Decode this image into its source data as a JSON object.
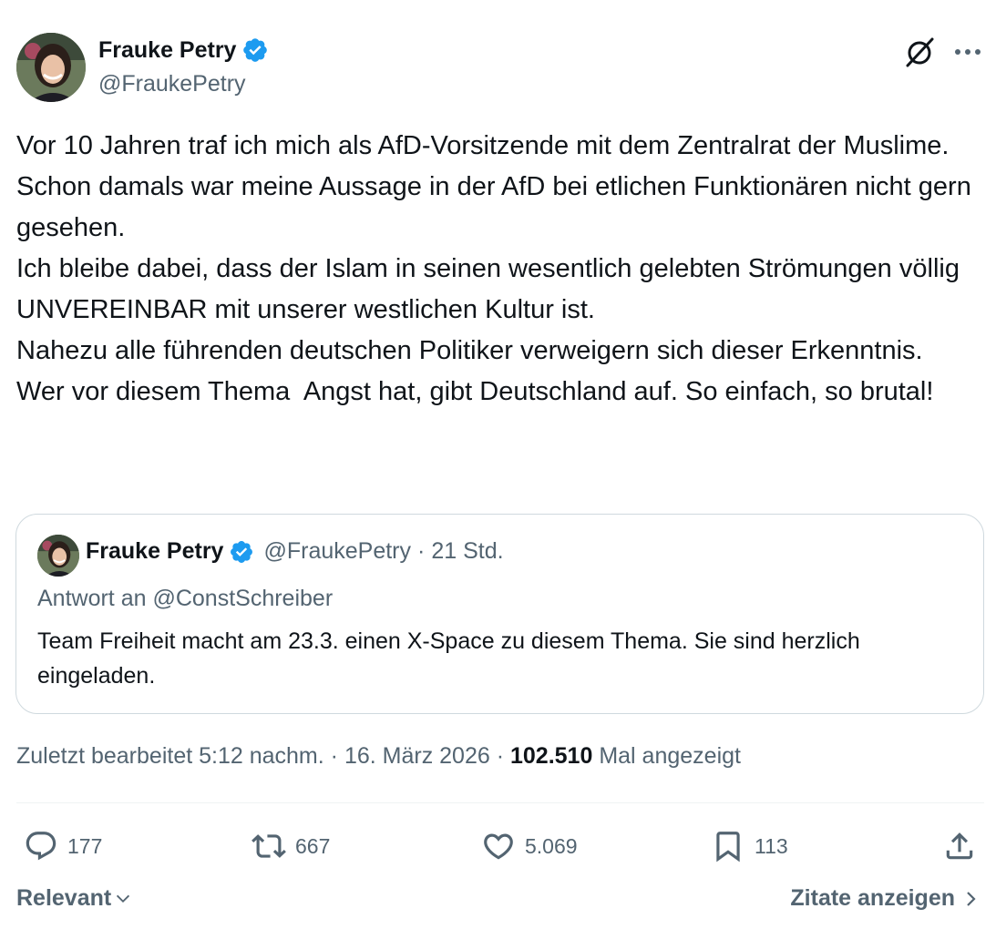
{
  "author": {
    "display_name": "Frauke Petry",
    "handle": "@FraukePetry",
    "verified_icon": "verified-badge-icon"
  },
  "header": {
    "grok_icon": "slashed-circle-icon",
    "more_icon": "more-dots-icon"
  },
  "tweet": {
    "text": "Vor 10 Jahren traf ich mich als AfD-Vorsitzende mit dem Zentralrat der Muslime. Schon damals war meine Aussage in der AfD bei etlichen Funktionären nicht gern gesehen.\nIch bleibe dabei, dass der Islam in seinen wesentlich gelebten Strömungen völlig UNVEREINBAR mit unserer westlichen Kultur ist.\nNahezu alle führenden deutschen Politiker verweigern sich dieser Erkenntnis.\nWer vor diesem Thema  Angst hat, gibt Deutschland auf. So einfach, so brutal!"
  },
  "quote": {
    "display_name": "Frauke Petry",
    "handle": "@FraukePetry",
    "separator": "·",
    "time": "21 Std.",
    "reply_prefix": "Antwort an",
    "reply_to": "@ConstSchreiber",
    "text": "Team Freiheit macht am 23.3. einen X-Space zu diesem Thema. Sie sind herzlich eingeladen."
  },
  "meta": {
    "edited": "Zuletzt bearbeitet 5:12 nachm.",
    "separator": "·",
    "date": "16. März 2026",
    "views_count": "102.510",
    "views_label": "Mal angezeigt"
  },
  "actions": {
    "replies": "177",
    "reposts": "667",
    "likes": "5.069",
    "bookmarks": "113"
  },
  "footer": {
    "sort_label": "Relevant",
    "quotes_label": "Zitate anzeigen"
  },
  "colors": {
    "text_primary": "#0f1419",
    "text_secondary": "#536471",
    "verified_blue": "#1d9bf0",
    "border": "#cfd9de"
  }
}
